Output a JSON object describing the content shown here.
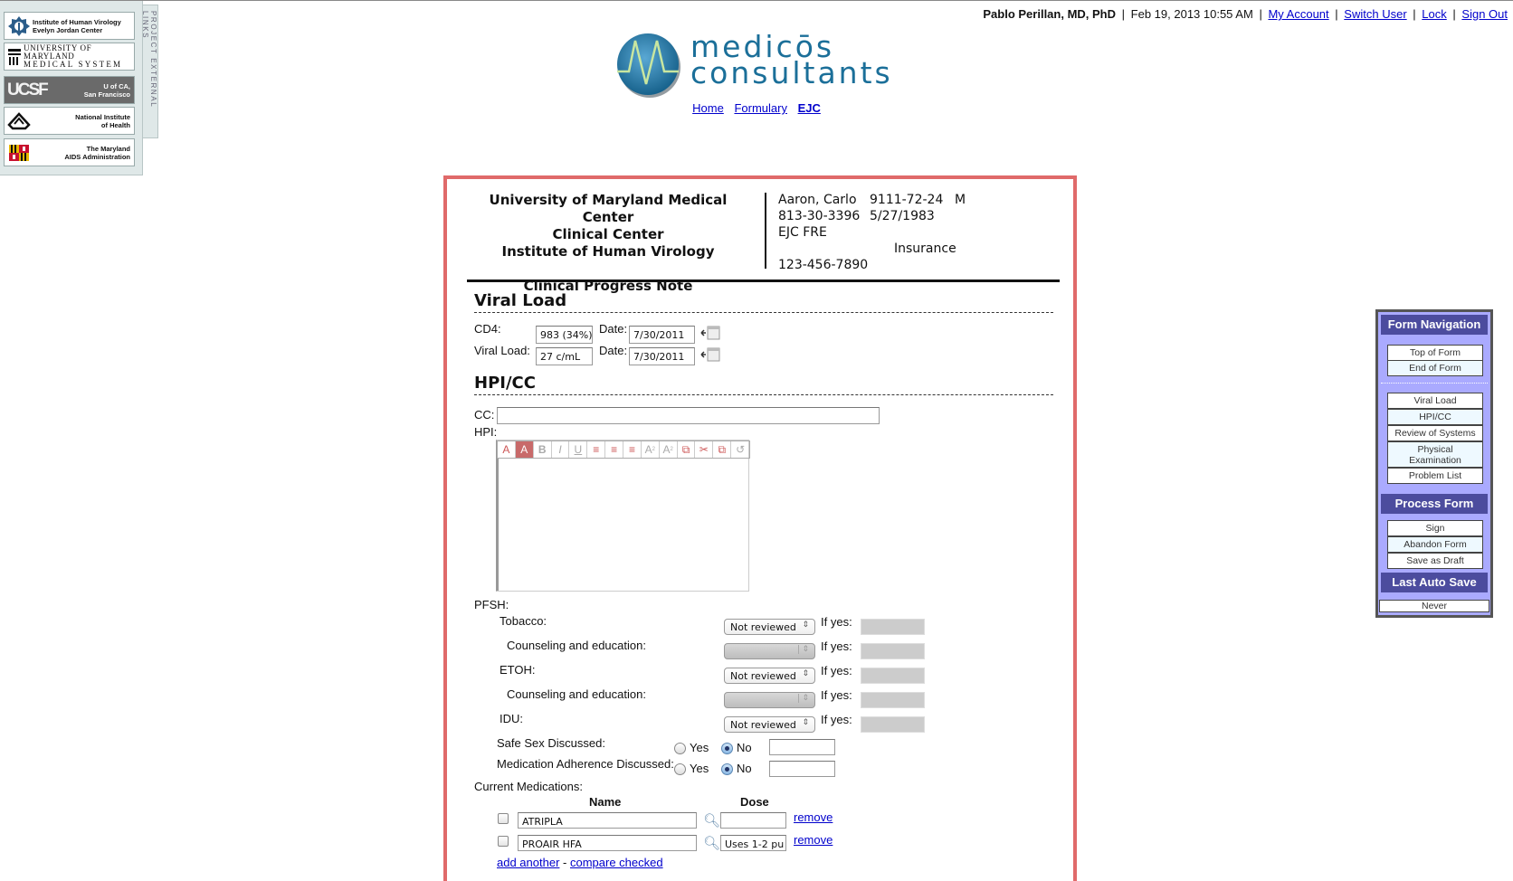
{
  "external_links": {
    "tab_label": "PROJECT EXTERNAL LINKS",
    "items": [
      {
        "name": "Institute of Human Virology",
        "line1": "Institute of Human Virology",
        "line2": "Evelyn Jordan Center"
      },
      {
        "name": "University of Maryland Medical System",
        "line1": "UNIVERSITY OF MARYLAND",
        "line2": "MEDICAL SYSTEM"
      },
      {
        "name": "UCSF",
        "logo": "UCSF",
        "line1": "U of CA,",
        "line2": "San Francisco"
      },
      {
        "name": "National Institute of Health",
        "line1": "National Institute",
        "line2": "of Health"
      },
      {
        "name": "The Maryland AIDS Administration",
        "line1": "The Maryland",
        "line2": "AIDS Administration"
      }
    ]
  },
  "user_bar": {
    "user_name": "Pablo Perillan, MD, PhD",
    "datetime": "Feb 19, 2013 10:55 AM",
    "links": [
      "My Account",
      "Switch User",
      "Lock",
      "Sign Out"
    ],
    "separator": "|"
  },
  "brand": {
    "line1": "medicōs",
    "line2": "consultants",
    "colors": {
      "circle": "#1b6f99",
      "text": "#1b6f99",
      "wave": "#c8e6a0"
    }
  },
  "main_nav": [
    {
      "label": "Home",
      "active": false
    },
    {
      "label": "Formulary",
      "active": false
    },
    {
      "label": "EJC",
      "active": true
    }
  ],
  "form_header": {
    "org_lines": [
      "University of Maryland Medical Center",
      "Clinical Center",
      "Institute of Human Virology"
    ],
    "note_title": "Clinical Progress Note",
    "patient": {
      "name": "Aaron, Carlo",
      "mrn": "9111-72-24",
      "sex": "M",
      "phone": "813-30-3396",
      "dob": "5/27/1983",
      "clinic": "EJC FRE",
      "insurance_label": "Insurance",
      "insurance_number": "123-456-7890"
    }
  },
  "viral_load": {
    "title": "Viral Load",
    "cd4_label": "CD4:",
    "cd4_value": "983 (34%)",
    "cd4_date_label": "Date:",
    "cd4_date": "7/30/2011",
    "vl_label": "Viral Load:",
    "vl_value": "27 c/mL",
    "vl_date_label": "Date:",
    "vl_date": "7/30/2011"
  },
  "hpi_cc": {
    "title": "HPI/CC",
    "cc_label": "CC:",
    "cc_value": "",
    "hpi_label": "HPI:",
    "toolbar_icons": [
      "font-color-icon",
      "highlight-color-icon",
      "bold-icon",
      "italic-icon",
      "underline-icon",
      "align-left-icon",
      "align-center-icon",
      "align-right-icon",
      "subscript-icon",
      "superscript-icon",
      "copy-icon",
      "cut-icon",
      "paste-icon",
      "undo-icon"
    ],
    "hpi_value": ""
  },
  "pfsh": {
    "label": "PFSH:",
    "if_yes_label": "If yes:",
    "rows": [
      {
        "label": "Tobacco:",
        "select": "Not reviewed",
        "disabled": false
      },
      {
        "label": "Counseling and education:",
        "select": "",
        "disabled": true
      },
      {
        "label": "ETOH:",
        "select": "Not reviewed",
        "disabled": false
      },
      {
        "label": "Counseling and education:",
        "select": "",
        "disabled": true
      },
      {
        "label": "IDU:",
        "select": "Not reviewed",
        "disabled": false
      }
    ],
    "discussed": [
      {
        "label": "Safe Sex Discussed:",
        "yes": "Yes",
        "no": "No",
        "selected": "No",
        "note": ""
      },
      {
        "label": "Medication Adherence Discussed:",
        "yes": "Yes",
        "no": "No",
        "selected": "No",
        "note": ""
      }
    ]
  },
  "medications": {
    "label": "Current Medications:",
    "col_name": "Name",
    "col_dose": "Dose",
    "rows": [
      {
        "name": "ATRIPLA",
        "dose": "",
        "checked": false,
        "remove": "remove"
      },
      {
        "name": "PROAIR HFA",
        "dose": "Uses 1-2 pu",
        "checked": false,
        "remove": "remove"
      }
    ],
    "add_another": "add another",
    "link_sep": " - ",
    "compare_checked": "compare checked"
  },
  "form_nav": {
    "title": "Form Navigation",
    "top_items": [
      "Top of Form",
      "End of Form"
    ],
    "section_items": [
      "Viral Load",
      "HPI/CC",
      "Review of Systems",
      "Physical Examination",
      "Problem List"
    ],
    "process_title": "Process Form",
    "process_items": [
      "Sign",
      "Abandon Form",
      "Save as Draft"
    ],
    "autosave_title": "Last Auto Save",
    "autosave_value": "Never"
  }
}
